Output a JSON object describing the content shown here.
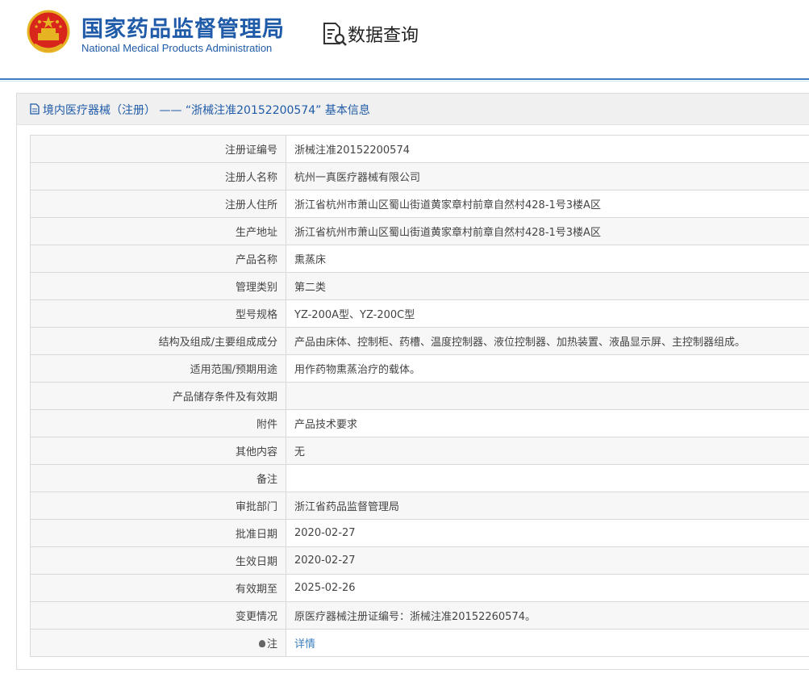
{
  "header": {
    "agency_cn": "国家药品监督管理局",
    "agency_en": "National Medical Products Administration",
    "section_title": "数据查询",
    "accent_color": "#1f5ba8"
  },
  "panel": {
    "title": "境内医疗器械（注册） —— “浙械注准20152200574” 基本信息"
  },
  "rows": [
    {
      "label": "注册证编号",
      "value": "浙械注准20152200574"
    },
    {
      "label": "注册人名称",
      "value": "杭州一真医疗器械有限公司"
    },
    {
      "label": "注册人住所",
      "value": "浙江省杭州市萧山区蜀山街道黄家章村前章自然村428-1号3楼A区"
    },
    {
      "label": "生产地址",
      "value": "浙江省杭州市萧山区蜀山街道黄家章村前章自然村428-1号3楼A区"
    },
    {
      "label": "产品名称",
      "value": "熏蒸床"
    },
    {
      "label": "管理类别",
      "value": "第二类"
    },
    {
      "label": "型号规格",
      "value": "YZ-200A型、YZ-200C型"
    },
    {
      "label": "结构及组成/主要组成成分",
      "value": "产品由床体、控制柜、药槽、温度控制器、液位控制器、加热装置、液晶显示屏、主控制器组成。"
    },
    {
      "label": "适用范围/预期用途",
      "value": "用作药物熏蒸治疗的载体。"
    },
    {
      "label": "产品储存条件及有效期",
      "value": ""
    },
    {
      "label": "附件",
      "value": "产品技术要求"
    },
    {
      "label": "其他内容",
      "value": "无"
    },
    {
      "label": "备注",
      "value": ""
    },
    {
      "label": "审批部门",
      "value": "浙江省药品监督管理局"
    },
    {
      "label": "批准日期",
      "value": "2020-02-27"
    },
    {
      "label": "生效日期",
      "value": "2020-02-27"
    },
    {
      "label": "有效期至",
      "value": "2025-02-26"
    },
    {
      "label": "变更情况",
      "value": "原医疗器械注册证编号：浙械注准20152260574。"
    }
  ],
  "note": {
    "label": "注",
    "link": "详情"
  },
  "icons": {
    "emblem": "national-emblem-icon",
    "query": "document-search-icon",
    "doc": "document-icon",
    "note": "bulb-icon"
  }
}
